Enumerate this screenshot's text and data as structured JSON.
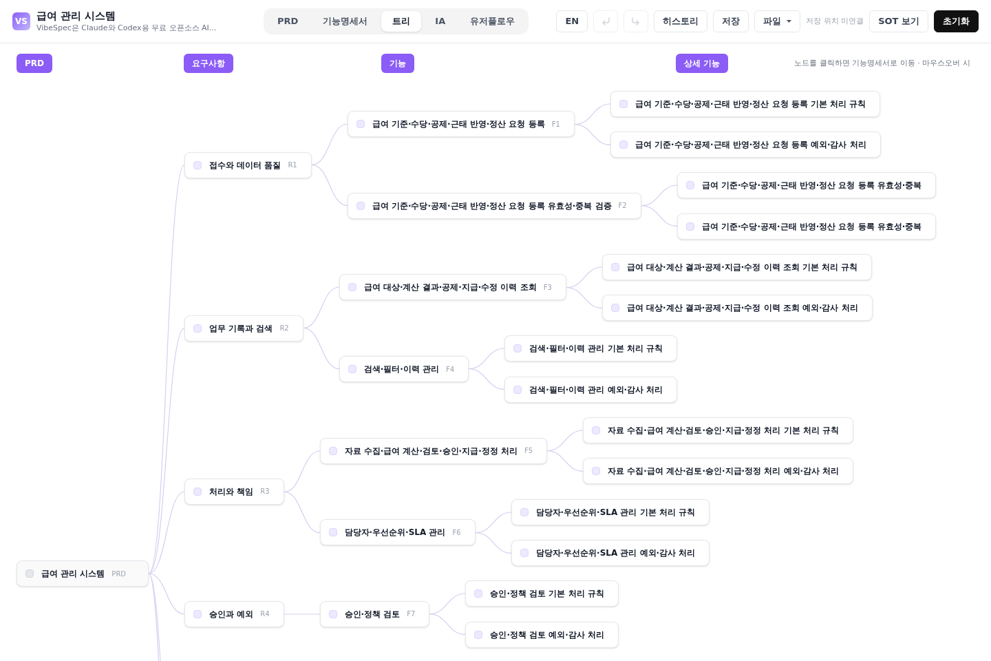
{
  "app": {
    "logo": "VS",
    "title": "급여 관리 시스템",
    "subtitle": "VibeSpec은 Claude와 Codex용 무료 오픈소스 AI..."
  },
  "tabs": [
    {
      "label": "PRD",
      "selected": false
    },
    {
      "label": "기능명세서",
      "selected": false
    },
    {
      "label": "트리",
      "selected": true
    },
    {
      "label": "IA",
      "selected": false
    },
    {
      "label": "유저플로우",
      "selected": false
    }
  ],
  "toolbar": [
    {
      "kind": "button",
      "label": "EN"
    },
    {
      "kind": "undo",
      "disabled": true
    },
    {
      "kind": "redo",
      "disabled": true
    },
    {
      "kind": "button",
      "label": "히스토리"
    },
    {
      "kind": "button",
      "label": "저장"
    },
    {
      "kind": "menu",
      "label": "파일"
    },
    {
      "kind": "status",
      "label": "저장 위치 미연결"
    },
    {
      "kind": "button",
      "label": "SOT 보기"
    },
    {
      "kind": "primary",
      "label": "초기화"
    }
  ],
  "columns": [
    "PRD",
    "요구사항",
    "기능",
    "상세 기능"
  ],
  "hint": "노드를 클릭하면 기능명세서로 이동 · 마우스오버 시",
  "tree": {
    "label": "급여 관리 시스템",
    "tag": "PRD",
    "checked": false,
    "children": [
      {
        "label": "접수와 데이터 품질",
        "tag": "R1",
        "checked": false,
        "children": [
          {
            "label": "급여 기준·수당·공제·근태 반영·정산 요청 등록",
            "tag": "F1",
            "checked": false,
            "children": [
              {
                "label": "급여 기준·수당·공제·근태 반영·정산 요청 등록 기본 처리 규칙",
                "checked": false
              },
              {
                "label": "급여 기준·수당·공제·근태 반영·정산 요청 등록 예외·감사 처리",
                "checked": false
              }
            ]
          },
          {
            "label": "급여 기준·수당·공제·근태 반영·정산 요청 등록 유효성·중복 검증",
            "tag": "F2",
            "checked": false,
            "children": [
              {
                "label": "급여 기준·수당·공제·근태 반영·정산 요청 등록 유효성·중복",
                "checked": false
              },
              {
                "label": "급여 기준·수당·공제·근태 반영·정산 요청 등록 유효성·중복",
                "checked": false
              }
            ]
          }
        ]
      },
      {
        "label": "업무 기록과 검색",
        "tag": "R2",
        "checked": false,
        "children": [
          {
            "label": "급여 대상·계산 결과·공제·지급·수정 이력 조회",
            "tag": "F3",
            "checked": false,
            "children": [
              {
                "label": "급여 대상·계산 결과·공제·지급·수정 이력 조회 기본 처리 규칙",
                "checked": false
              },
              {
                "label": "급여 대상·계산 결과·공제·지급·수정 이력 조회 예외·감사 처리",
                "checked": false
              }
            ]
          },
          {
            "label": "검색·필터·이력 관리",
            "tag": "F4",
            "checked": false,
            "children": [
              {
                "label": "검색·필터·이력 관리 기본 처리 규칙",
                "checked": false
              },
              {
                "label": "검색·필터·이력 관리 예외·감사 처리",
                "checked": false
              }
            ]
          }
        ]
      },
      {
        "label": "처리와 책임",
        "tag": "R3",
        "checked": false,
        "children": [
          {
            "label": "자료 수집·급여 계산·검토·승인·지급·정정 처리",
            "tag": "F5",
            "checked": false,
            "children": [
              {
                "label": "자료 수집·급여 계산·검토·승인·지급·정정 처리 기본 처리 규칙",
                "checked": false
              },
              {
                "label": "자료 수집·급여 계산·검토·승인·지급·정정 처리 예외·감사 처리",
                "checked": false
              }
            ]
          },
          {
            "label": "담당자·우선순위·SLA 관리",
            "tag": "F6",
            "checked": false,
            "children": [
              {
                "label": "담당자·우선순위·SLA 관리 기본 처리 규칙",
                "checked": false
              },
              {
                "label": "담당자·우선순위·SLA 관리 예외·감사 처리",
                "checked": false
              }
            ]
          }
        ]
      },
      {
        "label": "승인과 예외",
        "tag": "R4",
        "checked": false,
        "children": [
          {
            "label": "승인·정책 검토",
            "tag": "F7",
            "checked": false,
            "children": [
              {
                "label": "승인·정책 검토 기본 처리 규칙",
                "checked": false
              },
              {
                "label": "승인·정책 검토 예외·감사 처리",
                "checked": false
              }
            ]
          }
        ]
      }
    ]
  }
}
